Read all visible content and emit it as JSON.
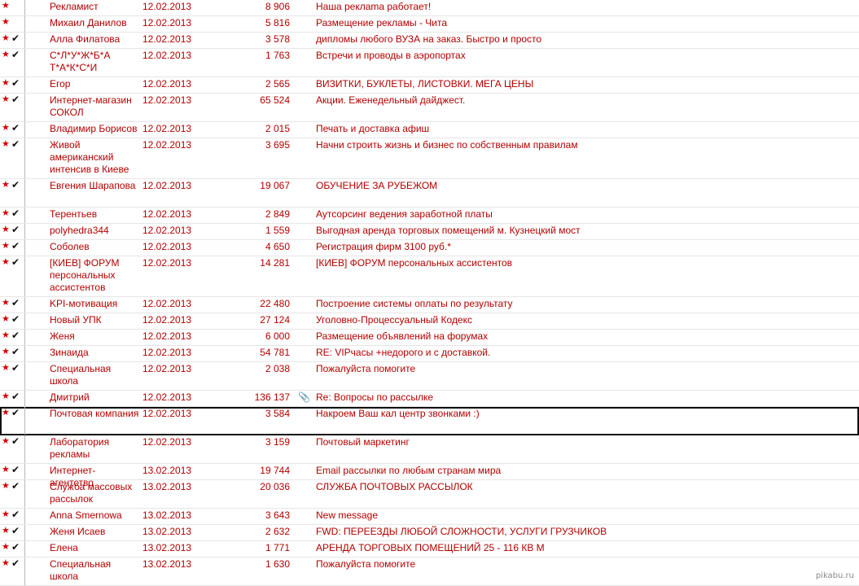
{
  "rows": [
    {
      "sender": "Рекламист",
      "date": "12.02.2013",
      "size": "8 906",
      "subject": "Наша реклama работает!",
      "starred": true,
      "checked": false,
      "attachment": false,
      "selected": false,
      "lines": 1
    },
    {
      "sender": "Михаил Данилов",
      "date": "12.02.2013",
      "size": "5 816",
      "subject": "Размещение рекламы - Чита",
      "starred": true,
      "checked": false,
      "attachment": false,
      "selected": false,
      "lines": 1
    },
    {
      "sender": "Алла Филатова",
      "date": "12.02.2013",
      "size": "3 578",
      "subject": "дипломы любого ВУЗА на заказ. Быстро и просто",
      "starred": true,
      "checked": true,
      "attachment": false,
      "selected": false,
      "lines": 1
    },
    {
      "sender": "С*Л*У*Ж*Б*А Т*А*К*С*И",
      "date": "12.02.2013",
      "size": "1 763",
      "subject": "Встречи и проводы в аэропортах",
      "starred": true,
      "checked": true,
      "attachment": false,
      "selected": false,
      "lines": 2
    },
    {
      "sender": "Егор",
      "date": "12.02.2013",
      "size": "2 565",
      "subject": "ВИЗИТКИ, БУКЛЕТЫ, ЛИСТОВКИ. МЕГА ЦЕНЫ",
      "starred": true,
      "checked": true,
      "attachment": false,
      "selected": false,
      "lines": 1
    },
    {
      "sender": "Интернет-магазин СОКОЛ",
      "date": "12.02.2013",
      "size": "65 524",
      "subject": "Акции. Еженедельный дайджест.",
      "starred": true,
      "checked": true,
      "attachment": false,
      "selected": false,
      "lines": 2
    },
    {
      "sender": "Владимир Борисов",
      "date": "12.02.2013",
      "size": "2 015",
      "subject": "Печать и доставка афиш",
      "starred": true,
      "checked": true,
      "attachment": false,
      "selected": false,
      "lines": 1
    },
    {
      "sender": "Живой американский интенсив в Киеве",
      "date": "12.02.2013",
      "size": "3 695",
      "subject": "Начни строить жизнь и бизнес по собственным правилам",
      "starred": true,
      "checked": true,
      "attachment": false,
      "selected": false,
      "lines": 3
    },
    {
      "sender": "Евгения Шарапова",
      "date": "12.02.2013",
      "size": "19 067",
      "subject": "ОБУЧЕНИЕ ЗА РУБЕЖОМ",
      "starred": true,
      "checked": true,
      "attachment": false,
      "selected": false,
      "lines": 2
    },
    {
      "sender": "Терентьев",
      "date": "12.02.2013",
      "size": "2 849",
      "subject": "Аутсорсинг ведения заработной платы",
      "starred": true,
      "checked": true,
      "attachment": false,
      "selected": false,
      "lines": 1
    },
    {
      "sender": "polyhedra344",
      "date": "12.02.2013",
      "size": "1 559",
      "subject": "Выгодная аренда торговых помещений м. Кузнецкий мост",
      "starred": true,
      "checked": true,
      "attachment": false,
      "selected": false,
      "lines": 1
    },
    {
      "sender": "Соболев",
      "date": "12.02.2013",
      "size": "4 650",
      "subject": "Регистрация фирм 3100 руб.*",
      "starred": true,
      "checked": true,
      "attachment": false,
      "selected": false,
      "lines": 1
    },
    {
      "sender": "[КИЕВ] ФОРУМ персональных ассистентов",
      "date": "12.02.2013",
      "size": "14 281",
      "subject": "[КИЕВ] ФОРУМ персональных ассистентов",
      "starred": true,
      "checked": true,
      "attachment": false,
      "selected": false,
      "lines": 3
    },
    {
      "sender": "KPI-мотивация",
      "date": "12.02.2013",
      "size": "22 480",
      "subject": "Построение системы оплаты по результату",
      "starred": true,
      "checked": true,
      "attachment": false,
      "selected": false,
      "lines": 1
    },
    {
      "sender": "Новый УПК",
      "date": "12.02.2013",
      "size": "27 124",
      "subject": "Уголовно-Процессуальный Кодекс",
      "starred": true,
      "checked": true,
      "attachment": false,
      "selected": false,
      "lines": 1
    },
    {
      "sender": "Женя",
      "date": "12.02.2013",
      "size": "6 000",
      "subject": "Размещение объявлений на форумах",
      "starred": true,
      "checked": true,
      "attachment": false,
      "selected": false,
      "lines": 1
    },
    {
      "sender": "Зинаида",
      "date": "12.02.2013",
      "size": "54 781",
      "subject": "RE: VIPчасы  +недорого и с доставкой.",
      "starred": true,
      "checked": true,
      "attachment": false,
      "selected": false,
      "lines": 1
    },
    {
      "sender": "Специальная школа",
      "date": "12.02.2013",
      "size": "2 038",
      "subject": "Пожалуйста помогите",
      "starred": true,
      "checked": true,
      "attachment": false,
      "selected": false,
      "lines": 2
    },
    {
      "sender": "Дмитрий",
      "date": "12.02.2013",
      "size": "136 137",
      "subject": "Re: Вопросы по рассылке",
      "starred": true,
      "checked": true,
      "attachment": true,
      "selected": false,
      "lines": 1
    },
    {
      "sender": "Почтовая компания",
      "date": "12.02.2013",
      "size": "3 584",
      "subject": "Накроем Ваш кал центр звонками :)",
      "starred": true,
      "checked": true,
      "attachment": false,
      "selected": true,
      "lines": 2
    },
    {
      "sender": "Лаборатория рекламы",
      "date": "12.02.2013",
      "size": "3 159",
      "subject": "Почтовый маркетинг",
      "starred": true,
      "checked": true,
      "attachment": false,
      "selected": false,
      "lines": 2
    },
    {
      "sender": "Интернет-агентство",
      "date": "13.02.2013",
      "size": "19 744",
      "subject": "Email рассылки по любым странам мира",
      "starred": true,
      "checked": true,
      "attachment": false,
      "selected": false,
      "lines": 1
    },
    {
      "sender": "Служба массовых рассылок",
      "date": "13.02.2013",
      "size": "20 036",
      "subject": "СЛУЖБА ПОЧТОВЫХ РАССЫЛОК",
      "starred": true,
      "checked": true,
      "attachment": false,
      "selected": false,
      "lines": 2
    },
    {
      "sender": "Anna Smernowa",
      "date": "13.02.2013",
      "size": "3 643",
      "subject": "New message",
      "starred": true,
      "checked": true,
      "attachment": false,
      "selected": false,
      "lines": 1
    },
    {
      "sender": "Женя Исаев",
      "date": "13.02.2013",
      "size": "2 632",
      "subject": "FWD: ПЕРЕЕЗДЫ ЛЮБОЙ СЛОЖНОСТИ, УСЛУГИ ГРУЗЧИКОВ",
      "starred": true,
      "checked": true,
      "attachment": false,
      "selected": false,
      "lines": 1
    },
    {
      "sender": "Елена",
      "date": "13.02.2013",
      "size": "1 771",
      "subject": "АРЕНДА ТОРГОВЫХ ПОМЕЩЕНИЙ 25  - 116 КВ М",
      "starred": true,
      "checked": true,
      "attachment": false,
      "selected": false,
      "lines": 1
    },
    {
      "sender": "Специальная школа",
      "date": "13.02.2013",
      "size": "1 630",
      "subject": "Пожалуйста помогите",
      "starred": true,
      "checked": true,
      "attachment": false,
      "selected": false,
      "lines": 2
    }
  ],
  "icons": {
    "star": "star-icon",
    "check": "checkmark-icon",
    "attachment": "paperclip-icon"
  },
  "colors": {
    "text": "#b20000",
    "star": "#d40000",
    "check": "#111111",
    "selected_border": "#111111"
  },
  "watermark": "pikabu.ru"
}
